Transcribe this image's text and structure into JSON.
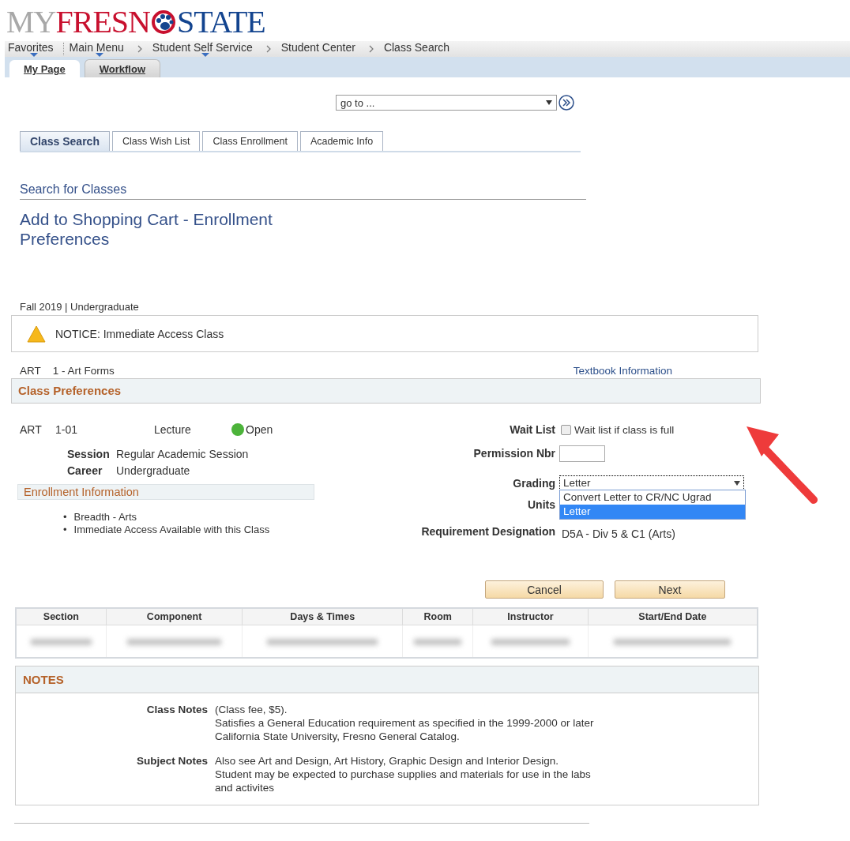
{
  "logo": [
    {
      "text": "MY",
      "color": "#a8a8a8"
    },
    {
      "text": "FRESN",
      "color": "#c8102e"
    },
    {
      "text": "STATE",
      "color": "#13448f"
    }
  ],
  "nav": {
    "items": [
      {
        "label": "Favorites",
        "menu": true
      },
      {
        "label": "Main Menu",
        "menu": true
      },
      {
        "label": "Student Self Service",
        "menu": true
      },
      {
        "label": "Student Center",
        "menu": false
      },
      {
        "label": "Class Search",
        "menu": false
      }
    ]
  },
  "page_tabs": [
    {
      "label": "My Page",
      "selected": true
    },
    {
      "label": "Workflow",
      "selected": false
    }
  ],
  "goto": {
    "value": "go to ..."
  },
  "tabs": [
    {
      "label": "Class Search",
      "selected": true
    },
    {
      "label": "Class Wish List",
      "selected": false
    },
    {
      "label": "Class Enrollment",
      "selected": false
    },
    {
      "label": "Academic Info",
      "selected": false
    }
  ],
  "subtitle": "Search for Classes",
  "title": "Add to Shopping Cart - Enrollment Preferences",
  "term": "Fall 2019 | Undergraduate",
  "notice": "NOTICE:  Immediate Access Class",
  "course": {
    "subject": "ART",
    "title": "1 - Art Forms",
    "link": "Textbook Information"
  },
  "preferences": {
    "header": "Class Preferences",
    "class": {
      "subject": "ART",
      "section": "1-01",
      "component": "Lecture",
      "status": "Open",
      "color": "#4cb33a"
    },
    "details": [
      {
        "label": "Session",
        "value": "Regular Academic Session"
      },
      {
        "label": "Career",
        "value": "Undergraduate"
      }
    ],
    "enrollment_header": "Enrollment Information",
    "enrollment_items": [
      {
        "marker": "•",
        "text": "Breadth - Arts"
      },
      {
        "marker": "•",
        "text": "Immediate Access Available with this Class"
      }
    ],
    "wait_list": {
      "label": "Wait List",
      "option": "Wait list if class is full",
      "checked": false
    },
    "permission": {
      "label": "Permission Nbr"
    },
    "grading": {
      "label": "Grading",
      "value": "Letter",
      "expanded": true,
      "options": [
        {
          "label": "Convert Letter to CR/NC Ugrad",
          "selected": false
        },
        {
          "label": "Letter",
          "selected": true
        }
      ]
    },
    "units": {
      "label": "Units"
    },
    "requirement": {
      "label": "Requirement Designation",
      "value": "D5A - Div 5 & C1 (Arts)"
    }
  },
  "buttons": [
    "Cancel",
    "Next"
  ],
  "table": {
    "columns": [
      "Section",
      "Component",
      "Days & Times",
      "Room",
      "Instructor",
      "Start/End Date"
    ]
  },
  "notes": {
    "header": "NOTES",
    "items": [
      {
        "label": "Class Notes",
        "lines": [
          "(Class fee, $5).",
          "Satisfies a General Education requirement as specified in the 1999-2000 or later",
          "California State University, Fresno General Catalog."
        ]
      },
      {
        "label": "Subject Notes",
        "lines": [
          "Also see Art and Design, Art History, Graphic Design and Interior Design.",
          "Student may be expected to purchase supplies and materials for use in the labs",
          "and activites"
        ]
      }
    ]
  }
}
